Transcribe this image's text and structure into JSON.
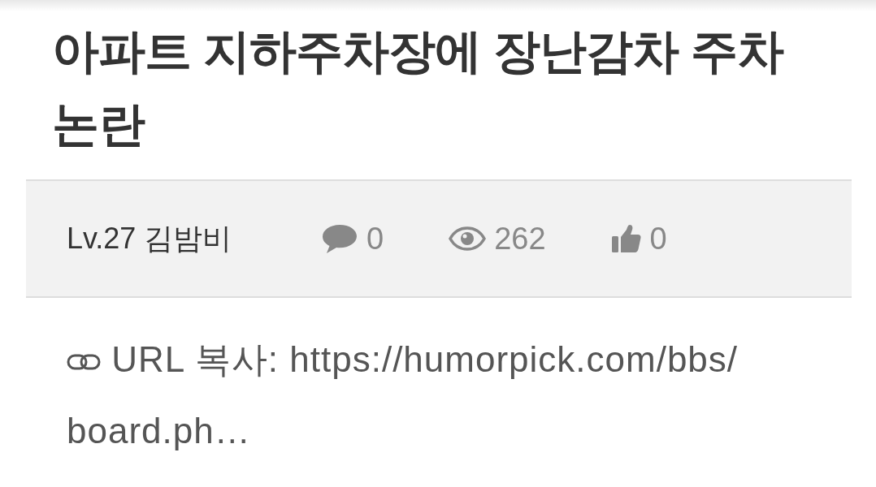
{
  "title": "아파트 지하주차장에 장난감차 주차 논란",
  "meta": {
    "author": "Lv.27 김밤비",
    "stats": [
      {
        "kind": "comments",
        "count": "0"
      },
      {
        "kind": "views",
        "count": "262"
      },
      {
        "kind": "likes",
        "count": "0"
      }
    ]
  },
  "url": {
    "label": "URL 복사:",
    "value": "https://humorpick.com/bbs/board.ph…"
  }
}
